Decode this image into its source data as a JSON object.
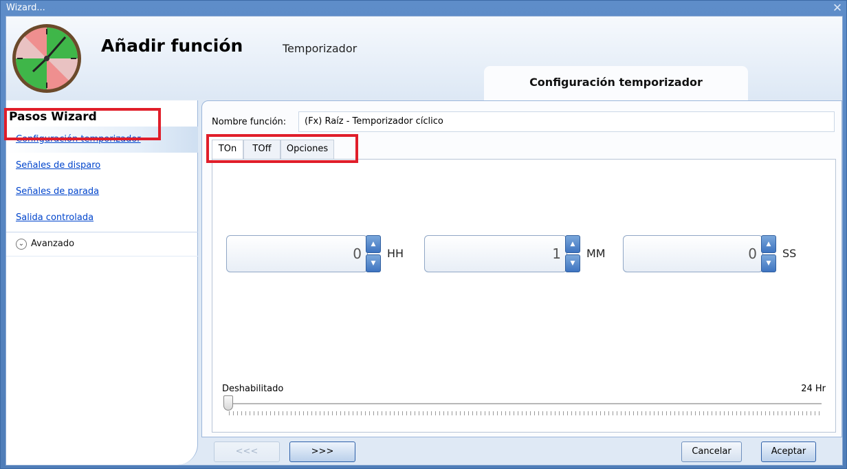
{
  "window": {
    "title": "Wizard...",
    "close_icon": "close-icon"
  },
  "header": {
    "title": "Añadir función",
    "subtitle": "Temporizador",
    "step_tab": "Configuración temporizador",
    "logo_icon": "clock-logo-icon"
  },
  "sidebar": {
    "title": "Pasos Wizard",
    "items": [
      {
        "label": "Configuración temporizador",
        "active": true
      },
      {
        "label": "Señales de disparo",
        "active": false
      },
      {
        "label": "Señales de parada",
        "active": false
      },
      {
        "label": "Salida controlada",
        "active": false
      }
    ],
    "advanced": {
      "label": "Avanzado",
      "icon": "chevron-down-icon"
    }
  },
  "form": {
    "name_label": "Nombre función:",
    "name_value": "(Fx) Raíz - Temporizador cíclico",
    "tabs": [
      {
        "label": "TOn",
        "selected": true
      },
      {
        "label": "TOff",
        "selected": false
      },
      {
        "label": "Opciones",
        "selected": false
      }
    ],
    "time": {
      "hours": {
        "value": "0",
        "unit": "HH"
      },
      "minutes": {
        "value": "1",
        "unit": "MM"
      },
      "seconds": {
        "value": "0",
        "unit": "SS"
      }
    },
    "slider": {
      "min_label": "Deshabilitado",
      "max_label": "24 Hr",
      "value": 0
    }
  },
  "footer": {
    "back_label": "<<<",
    "next_label": ">>>",
    "cancel_label": "Cancelar",
    "accept_label": "Aceptar"
  },
  "colors": {
    "highlight": "#e01e2a",
    "link": "#0044cc",
    "accent": "#3e74c0"
  }
}
